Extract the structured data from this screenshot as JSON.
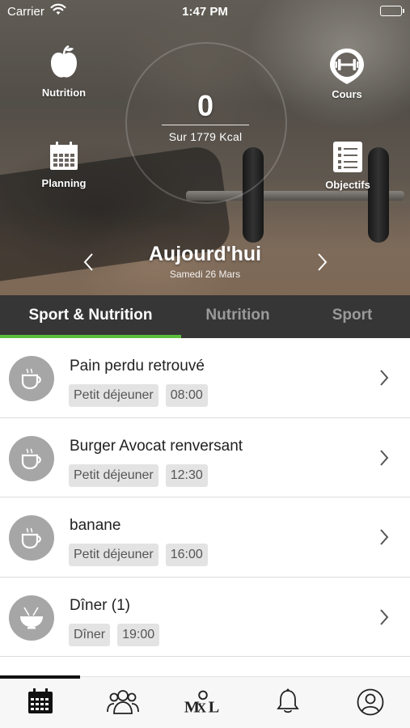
{
  "status_bar": {
    "carrier": "Carrier",
    "time": "1:47 PM"
  },
  "hero": {
    "shortcuts": {
      "nutrition": {
        "label": "Nutrition",
        "icon": "apple-icon"
      },
      "cours": {
        "label": "Cours",
        "icon": "dumbbell-pin-icon"
      },
      "planning": {
        "label": "Planning",
        "icon": "calendar-icon"
      },
      "objectifs": {
        "label": "Objectifs",
        "icon": "checklist-icon"
      }
    },
    "kcal_value": "0",
    "kcal_target": "Sur 1779 Kcal",
    "day_title": "Aujourd'hui",
    "day_date": "Samedi 26 Mars"
  },
  "tabs": [
    {
      "label": "Sport & Nutrition",
      "active": true
    },
    {
      "label": "Nutrition",
      "active": false
    },
    {
      "label": "Sport",
      "active": false
    }
  ],
  "meals": [
    {
      "name": "Pain perdu retrouvé",
      "category": "Petit déjeuner",
      "time": "08:00",
      "icon": "coffee-cup-icon"
    },
    {
      "name": "Burger Avocat renversant",
      "category": "Petit déjeuner",
      "time": "12:30",
      "icon": "coffee-cup-icon"
    },
    {
      "name": "banane",
      "category": "Petit déjeuner",
      "time": "16:00",
      "icon": "coffee-cup-icon"
    },
    {
      "name": "Dîner (1)",
      "category": "Dîner",
      "time": "19:00",
      "icon": "noodle-bowl-icon"
    }
  ],
  "tabbar": {
    "items": [
      "calendar-icon",
      "community-icon",
      "mxl-logo-icon",
      "bell-icon",
      "profile-icon"
    ],
    "active_index": 0
  },
  "colors": {
    "accent": "#5cbd3c",
    "tabs_bg": "#373636",
    "tag_bg": "#e3e3e3",
    "avatar_bg": "#a6a6a6"
  }
}
